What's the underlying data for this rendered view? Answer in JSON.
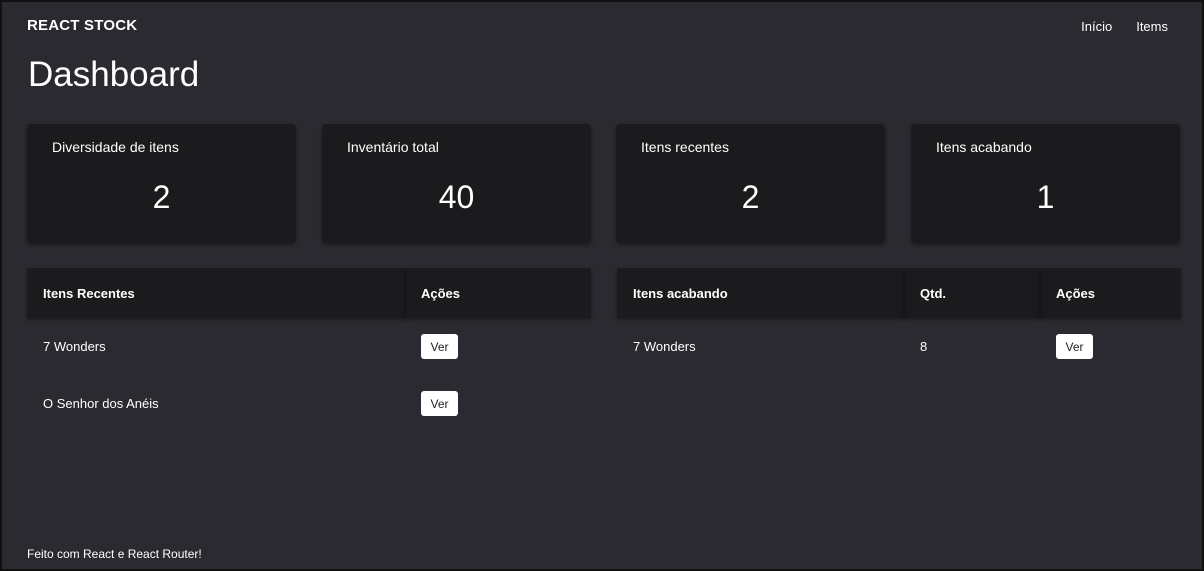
{
  "header": {
    "brand": "REACT STOCK",
    "nav": [
      "Início",
      "Items"
    ]
  },
  "page": {
    "title": "Dashboard"
  },
  "stats": [
    {
      "label": "Diversidade de itens",
      "value": "2"
    },
    {
      "label": "Inventário total",
      "value": "40"
    },
    {
      "label": "Itens recentes",
      "value": "2"
    },
    {
      "label": "Itens acabando",
      "value": "1"
    }
  ],
  "recent_table": {
    "headers": [
      "Itens Recentes",
      "Ações"
    ],
    "rows": [
      {
        "name": "7 Wonders",
        "action": "Ver"
      },
      {
        "name": "O Senhor dos Anéis",
        "action": "Ver"
      }
    ]
  },
  "low_table": {
    "headers": [
      "Itens acabando",
      "Qtd.",
      "Ações"
    ],
    "rows": [
      {
        "name": "7 Wonders",
        "qty": "8",
        "action": "Ver"
      }
    ]
  },
  "footer": {
    "text": "Feito com React e React Router!"
  }
}
